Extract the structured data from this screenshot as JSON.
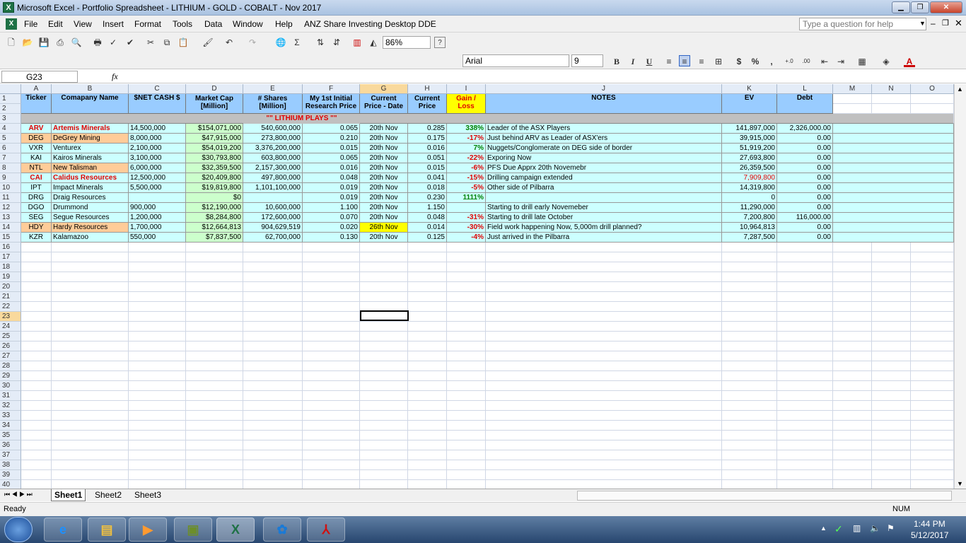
{
  "window": {
    "title": "Microsoft Excel - Portfolio Spreadsheet - LITHIUM - GOLD - COBALT - Nov 2017",
    "app_icon": "X"
  },
  "menu": [
    "File",
    "Edit",
    "View",
    "Insert",
    "Format",
    "Tools",
    "Data",
    "Window",
    "Help",
    "ANZ Share Investing Desktop DDE"
  ],
  "help_placeholder": "Type a question for help",
  "toolbar": {
    "zoom": "86%",
    "font": "Arial",
    "font_size": "9",
    "bold": "B",
    "italic": "I",
    "underline": "U",
    "currency": "$",
    "percent": "%",
    "comma": ",",
    "inc_dec": "+.0 .00",
    "dec_dec": ".00 +.0"
  },
  "formula": {
    "name_box": "G23",
    "fx": "fx",
    "content": ""
  },
  "columns": [
    "A",
    "B",
    "C",
    "D",
    "E",
    "F",
    "G",
    "H",
    "I",
    "J",
    "K",
    "L",
    "M",
    "N",
    "O"
  ],
  "headers": {
    "A": "Ticker",
    "B": "Comapany Name",
    "C": "$NET CASH $",
    "D1": "Market Cap",
    "D2": "[Million]",
    "E1": "# Shares",
    "E2": "[Million]",
    "F1": "My 1st Initial",
    "F2": "Research Price",
    "G1": "Current",
    "G2": "Price - Date",
    "H1": "Current",
    "H2": "Price",
    "I1": "Gain /",
    "I2": "Loss",
    "J": "NOTES",
    "K": "EV",
    "L": "Debt"
  },
  "section": "\"\"    LITHIUM PLAYS    \"\"",
  "rows": [
    {
      "tk": "ARV",
      "name": "Artemis Minerals",
      "cash": "14,500,000",
      "mcap": "$154,071,000",
      "shares": "540,600,000",
      "init": "0.065",
      "date": "20th Nov",
      "price": "0.285",
      "gain": "338%",
      "note": "Leader of the ASX Players",
      "ev": "141,897,000",
      "debt": "2,326,000.00"
    },
    {
      "tk": "DEG",
      "name": "DeGrey Mining",
      "cash": "8,000,000",
      "mcap": "$47,915,000",
      "shares": "273,800,000",
      "init": "0.210",
      "date": "20th Nov",
      "price": "0.175",
      "gain": "-17%",
      "note": "Just behind ARV as Leader of ASX'ers",
      "ev": "39,915,000",
      "debt": "0.00"
    },
    {
      "tk": "VXR",
      "name": "Venturex",
      "cash": "2,100,000",
      "mcap": "$54,019,200",
      "shares": "3,376,200,000",
      "init": "0.015",
      "date": "20th Nov",
      "price": "0.016",
      "gain": "7%",
      "note": "Nuggets/Conglomerate on DEG side of border",
      "ev": "51,919,200",
      "debt": "0.00"
    },
    {
      "tk": "KAI",
      "name": "Kairos Minerals",
      "cash": "3,100,000",
      "mcap": "$30,793,800",
      "shares": "603,800,000",
      "init": "0.065",
      "date": "20th Nov",
      "price": "0.051",
      "gain": "-22%",
      "note": "Exporing Now",
      "ev": "27,693,800",
      "debt": "0.00"
    },
    {
      "tk": "NTL",
      "name": "New Talisman",
      "cash": "6,000,000",
      "mcap": "$32,359,500",
      "shares": "2,157,300,000",
      "init": "0.016",
      "date": "20th Nov",
      "price": "0.015",
      "gain": "-6%",
      "note": "PFS Due Apprx 20th Novemebr",
      "ev": "26,359,500",
      "debt": "0.00"
    },
    {
      "tk": "CAI",
      "name": "Calidus Resources",
      "cash": "12,500,000",
      "mcap": "$20,409,800",
      "shares": "497,800,000",
      "init": "0.048",
      "date": "20th Nov",
      "price": "0.041",
      "gain": "-15%",
      "note": "Drilling campaign extended",
      "ev": "7,909,800",
      "debt": "0.00"
    },
    {
      "tk": "IPT",
      "name": "Impact Minerals",
      "cash": "5,500,000",
      "mcap": "$19,819,800",
      "shares": "1,101,100,000",
      "init": "0.019",
      "date": "20th Nov",
      "price": "0.018",
      "gain": "-5%",
      "note": "Other side of Pilbarra",
      "ev": "14,319,800",
      "debt": "0.00"
    },
    {
      "tk": "DRG",
      "name": "Draig Resources",
      "cash": "",
      "mcap": "$0",
      "shares": "",
      "init": "0.019",
      "date": "20th Nov",
      "price": "0.230",
      "gain": "1111%",
      "note": "",
      "ev": "0",
      "debt": "0.00"
    },
    {
      "tk": "DGO",
      "name": "Drummond",
      "cash": "900,000",
      "mcap": "$12,190,000",
      "shares": "10,600,000",
      "init": "1.100",
      "date": "20th Nov",
      "price": "1.150",
      "gain": "",
      "note": "Starting to drill early Novemeber",
      "ev": "11,290,000",
      "debt": "0.00"
    },
    {
      "tk": "SEG",
      "name": "Segue Resources",
      "cash": "1,200,000",
      "mcap": "$8,284,800",
      "shares": "172,600,000",
      "init": "0.070",
      "date": "20th Nov",
      "price": "0.048",
      "gain": "-31%",
      "note": "Starting to drill late October",
      "ev": "7,200,800",
      "debt": "116,000.00"
    },
    {
      "tk": "HDY",
      "name": "Hardy Resources",
      "cash": "1,700,000",
      "mcap": "$12,664,813",
      "shares": "904,629,519",
      "init": "0.020",
      "date": "26th Nov",
      "price": "0.014",
      "gain": "-30%",
      "note": "Field work happening Now, 5,000m drill planned?",
      "ev": "10,964,813",
      "debt": "0.00"
    },
    {
      "tk": "KZR",
      "name": "Kalamazoo",
      "cash": "550,000",
      "mcap": "$7,837,500",
      "shares": "62,700,000",
      "init": "0.130",
      "date": "20th Nov",
      "price": "0.125",
      "gain": "-4%",
      "note": "Just arrived in the Pilbarra",
      "ev": "7,287,500",
      "debt": "0.00"
    }
  ],
  "sheets": [
    "Sheet1",
    "Sheet2",
    "Sheet3"
  ],
  "status": {
    "left": "Ready",
    "right": "NUM"
  },
  "clock": {
    "time": "1:44 PM",
    "date": "5/12/2017"
  },
  "colors": {
    "header_blue": "#99ccff",
    "row_cyan": "#ccffff",
    "mcap_green": "#ccffcc",
    "highlight_orange": "#ffcc99",
    "gain_yellow": "#ffff00",
    "loss_red": "#e00000",
    "gain_green": "#008000"
  }
}
